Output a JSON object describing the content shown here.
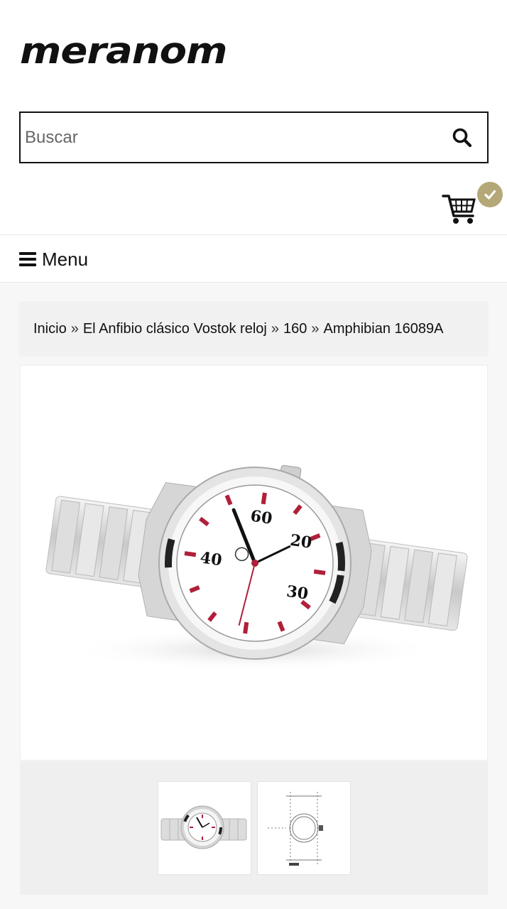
{
  "header": {
    "logo_text": "meranom",
    "search": {
      "placeholder": "Buscar",
      "value": ""
    },
    "cart_badge_icon": "check-icon"
  },
  "menu": {
    "label": "Menu"
  },
  "breadcrumb": {
    "items": [
      "Inicio",
      "El Anfibio clásico Vostok reloj",
      "160",
      "Amphibian 16089A"
    ],
    "separator": "»"
  },
  "product": {
    "main_image_alt": "Amphibian 16089A watch",
    "thumbnails": [
      "watch-photo",
      "watch-technical-drawing"
    ]
  },
  "colors": {
    "badge": "#b5a878",
    "dial_accent": "#b0203a"
  }
}
